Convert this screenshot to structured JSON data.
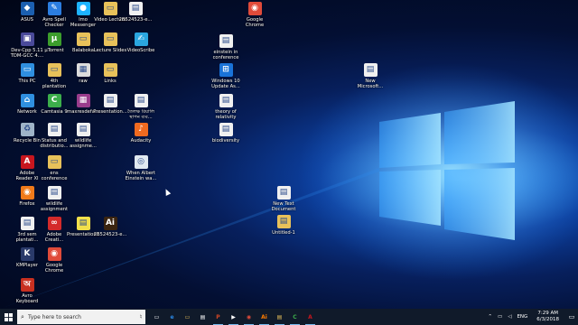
{
  "desktop_icons": [
    {
      "label": "ASUS",
      "icon": "asus-logo-icon",
      "color": "#1b5fb0",
      "glyph": "◆"
    },
    {
      "label": "Avro Spell\nChecker",
      "icon": "avro-spell-icon",
      "color": "#2b7de0",
      "glyph": "✎"
    },
    {
      "label": "Imo\nMessenger",
      "icon": "imo-icon",
      "color": "#1db3ff",
      "glyph": "●"
    },
    {
      "label": "Video Lecture",
      "icon": "folder-icon",
      "color": "#e8c15a",
      "glyph": "▭"
    },
    {
      "label": "2B524523-e...",
      "icon": "document-icon",
      "color": "#f0f0f0",
      "glyph": "▤"
    },
    {
      "label": "Google\nChrome",
      "icon": "chrome-icon",
      "color": "#e04b3a",
      "glyph": "◉"
    },
    {
      "label": "Dev-Cpp 5.11\nTDM-GCC 4....",
      "icon": "devcpp-icon",
      "color": "#4a4a9a",
      "glyph": "▣"
    },
    {
      "label": "µTorrent",
      "icon": "utorrent-icon",
      "color": "#3c9d2c",
      "glyph": "µ"
    },
    {
      "label": "Balaboka",
      "icon": "folder-icon",
      "color": "#e8c15a",
      "glyph": "▭"
    },
    {
      "label": "Lecture Slides",
      "icon": "folder-icon",
      "color": "#e8c15a",
      "glyph": "▭"
    },
    {
      "label": "VideoScribe",
      "icon": "videoscribe-icon",
      "color": "#2aa6df",
      "glyph": "✍"
    },
    {
      "label": "einstein in\nconference",
      "icon": "document-icon",
      "color": "#f0f0f0",
      "glyph": "▤"
    },
    {
      "label": "This PC",
      "icon": "computer-icon",
      "color": "#2f8fe0",
      "glyph": "▭"
    },
    {
      "label": "4th\nplantation",
      "icon": "folder-icon",
      "color": "#e8c15a",
      "glyph": "▭"
    },
    {
      "label": "raw",
      "icon": "image-file-icon",
      "color": "#dcdcdc",
      "glyph": "▦"
    },
    {
      "label": "Links",
      "icon": "folder-icon",
      "color": "#e8c15a",
      "glyph": "▭"
    },
    {
      "label": "Windows 10\nUpdate As...",
      "icon": "windows-update-icon",
      "color": "#1a73d8",
      "glyph": "⊞"
    },
    {
      "label": "New\nMicrosoft...",
      "icon": "word-document-icon",
      "color": "#f0f0f0",
      "glyph": "▤"
    },
    {
      "label": "Network",
      "icon": "network-icon",
      "color": "#2f8fe0",
      "glyph": "⌂"
    },
    {
      "label": "Camtasia 9",
      "icon": "camtasia-icon",
      "color": "#3cae4b",
      "glyph": "C"
    },
    {
      "label": "maxresdefa...",
      "icon": "image-file-icon",
      "color": "#9a3c8c",
      "glyph": "▦"
    },
    {
      "label": "Presentation...",
      "icon": "document-icon",
      "color": "#f0f0f0",
      "glyph": "▤"
    },
    {
      "label": "তৈলক্ষ রিয়ালি\nস্থাপন ব্যব...",
      "icon": "document-icon",
      "color": "#f0f0f0",
      "glyph": "▤"
    },
    {
      "label": "theory of\nrelativity",
      "icon": "document-icon",
      "color": "#f0f0f0",
      "glyph": "▤"
    },
    {
      "label": "Recycle Bin",
      "icon": "recycle-bin-icon",
      "color": "#9fb4c8",
      "glyph": "♻"
    },
    {
      "label": "Status and\ndistributio...",
      "icon": "word-document-icon",
      "color": "#f0f0f0",
      "glyph": "▤"
    },
    {
      "label": "wildlife\nassignme...",
      "icon": "document-icon",
      "color": "#f0f0f0",
      "glyph": "▤"
    },
    {
      "label": "Audacity",
      "icon": "audacity-icon",
      "color": "#f06a20",
      "glyph": "♪"
    },
    {
      "label": "biodiversity",
      "icon": "document-icon",
      "color": "#f0f0f0",
      "glyph": "▤"
    },
    {
      "label": "Adobe\nReader XI",
      "icon": "adobe-reader-icon",
      "color": "#c8161e",
      "glyph": "A"
    },
    {
      "label": "ens\nconference",
      "icon": "folder-icon",
      "color": "#e8c15a",
      "glyph": "▭"
    },
    {
      "label": "When Albert\nEinstein wa...",
      "icon": "media-file-icon",
      "color": "#e0e8f0",
      "glyph": "◎"
    },
    {
      "label": "Firefox",
      "icon": "firefox-icon",
      "color": "#f07a1a",
      "glyph": "◉"
    },
    {
      "label": "wildlife\nassignment",
      "icon": "document-icon",
      "color": "#f0f0f0",
      "glyph": "▤"
    },
    {
      "label": "New Text\nDocument",
      "icon": "text-document-icon",
      "color": "#f0f0f0",
      "glyph": "▤"
    },
    {
      "label": "3rd sem\nplantati...",
      "icon": "document-icon",
      "color": "#f0f0f0",
      "glyph": "▤"
    },
    {
      "label": "Adobe\nCreati...",
      "icon": "adobe-cloud-icon",
      "color": "#d42a2a",
      "glyph": "∞"
    },
    {
      "label": "Presentation1",
      "icon": "document-icon",
      "color": "#f2e04a",
      "glyph": "▤"
    },
    {
      "label": "2B524523-e...",
      "icon": "illustrator-icon",
      "color": "#3a2410",
      "glyph": "Ai"
    },
    {
      "label": "Untitled-1",
      "icon": "document-icon",
      "color": "#e8c15a",
      "glyph": "▤"
    },
    {
      "label": "KMPlayer",
      "icon": "kmplayer-icon",
      "color": "#2a3a6a",
      "glyph": "K"
    },
    {
      "label": "Google\nChrome",
      "icon": "chrome-icon",
      "color": "#e04b3a",
      "glyph": "◉"
    },
    {
      "label": "Avro\nKeyboard",
      "icon": "avro-keyboard-icon",
      "color": "#c83020",
      "glyph": "অ"
    }
  ],
  "taskbar": {
    "search_placeholder": "Type here to search",
    "apps": [
      {
        "icon": "task-view-icon",
        "color": "#ffffff",
        "glyph": "▭"
      },
      {
        "icon": "edge-icon",
        "color": "#2b8ae8",
        "glyph": "e"
      },
      {
        "icon": "file-explorer-icon",
        "color": "#e8c15a",
        "glyph": "▭"
      },
      {
        "icon": "store-icon",
        "color": "#ffffff",
        "glyph": "▤"
      },
      {
        "icon": "powerpoint-icon",
        "color": "#d24726",
        "glyph": "P"
      },
      {
        "icon": "media-player-icon",
        "color": "#ffffff",
        "glyph": "▶"
      },
      {
        "icon": "chrome-icon",
        "color": "#e04b3a",
        "glyph": "◉"
      },
      {
        "icon": "illustrator-icon",
        "color": "#ff7c00",
        "glyph": "Ai"
      },
      {
        "icon": "document-icon",
        "color": "#e8c15a",
        "glyph": "▤"
      },
      {
        "icon": "camtasia-icon",
        "color": "#3cae4b",
        "glyph": "C"
      },
      {
        "icon": "adobe-reader-icon",
        "color": "#c8161e",
        "glyph": "A"
      }
    ],
    "tray": {
      "chevron": "⌃",
      "language": "ENG",
      "time": "7:29 AM",
      "date": "6/3/2018",
      "notification_glyph": "▭"
    }
  }
}
